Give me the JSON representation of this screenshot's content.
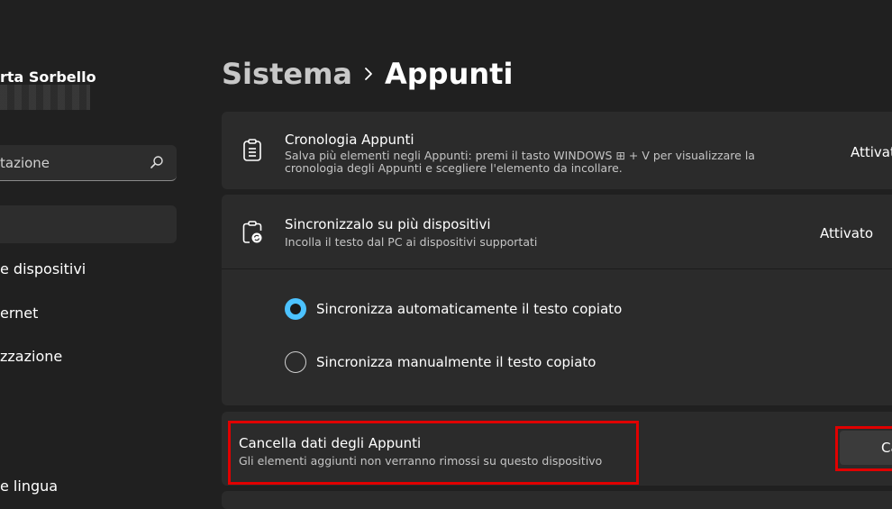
{
  "sidebar": {
    "user_name": "rta Sorbello",
    "search_placeholder": "tazione",
    "items": [
      {
        "label": "e dispositivi"
      },
      {
        "label": "ernet"
      },
      {
        "label": "zzazione"
      },
      {
        "label": "e lingua"
      }
    ]
  },
  "breadcrumb": {
    "parent": "Sistema",
    "current": "Appunti"
  },
  "clipboard_history": {
    "title": "Cronologia Appunti",
    "description": "Salva più elementi negli Appunti: premi il tasto WINDOWS ⊞ + V per visualizzare la cronologia degli Appunti e scegliere l'elemento da incollare.",
    "status": "Attivat"
  },
  "sync": {
    "title": "Sincronizzalo su più dispositivi",
    "description": "Incolla il testo dal PC ai dispositivi supportati",
    "status": "Attivato",
    "options": [
      {
        "label": "Sincronizza automaticamente il testo copiato",
        "selected": true
      },
      {
        "label": "Sincronizza manualmente il testo copiato",
        "selected": false
      }
    ]
  },
  "clear_data": {
    "title": "Cancella dati degli Appunti",
    "description": "Gli elementi aggiunti non verranno rimossi su questo dispositivo",
    "button_label": "Ca"
  },
  "colors": {
    "accent": "#4cc2ff",
    "highlight": "#e00000",
    "background": "#202020",
    "card": "#2b2b2b"
  }
}
